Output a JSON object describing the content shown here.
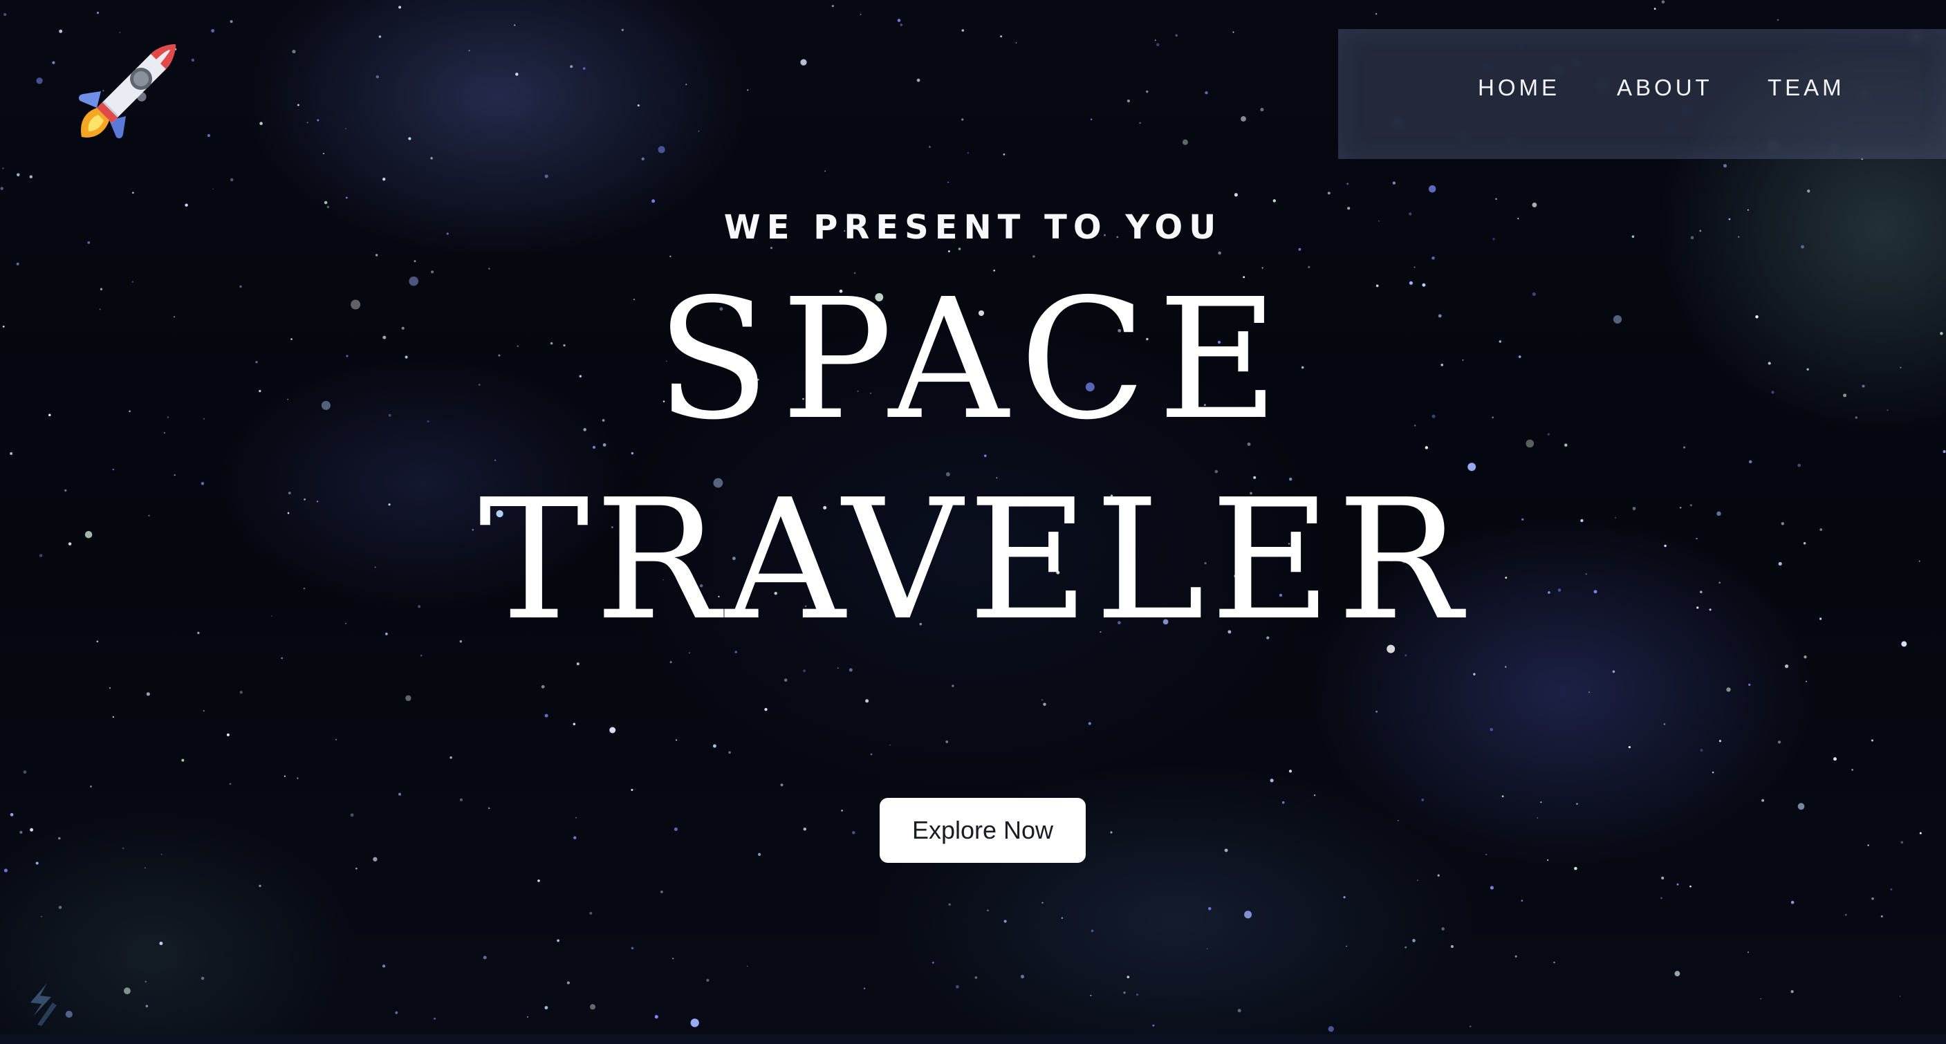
{
  "nav": {
    "items": [
      {
        "label": "HOME"
      },
      {
        "label": "ABOUT"
      },
      {
        "label": "TEAM"
      }
    ]
  },
  "hero": {
    "subtitle": "WE PRESENT TO YOU",
    "title_line1": "SPACE",
    "title_line2": "TRAVELER",
    "cta_label": "Explore Now"
  },
  "icons": {
    "logo": "rocket-icon",
    "corner": "lightning-mark-icon"
  },
  "colors": {
    "background": "#05070f",
    "text": "#ffffff",
    "nav_background": "#3a4258",
    "button_background": "#ffffff",
    "button_text": "#1a1c25"
  }
}
